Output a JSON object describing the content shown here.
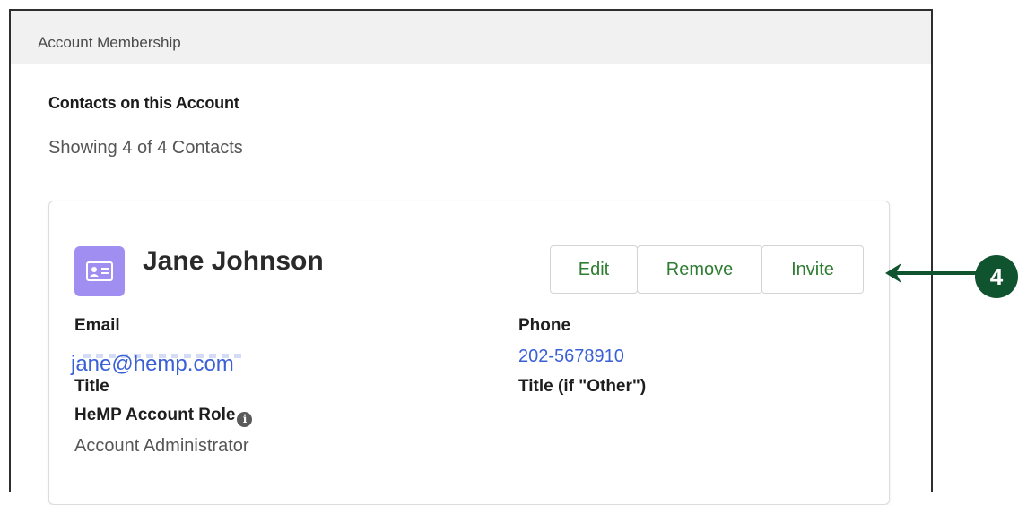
{
  "panel": {
    "header_title": "Account Membership",
    "section_title": "Contacts on this Account",
    "showing_text": "Showing 4 of 4 Contacts"
  },
  "contact": {
    "icon": "contact-card-icon",
    "name": "Jane Johnson",
    "actions": {
      "edit": "Edit",
      "remove": "Remove",
      "invite": "Invite"
    },
    "fields": {
      "email_label": "Email",
      "email_value": "jane@hemp.com",
      "phone_label": "Phone",
      "phone_value": "202-5678910",
      "title_label": "Title",
      "title_other_label": "Title (if \"Other\")",
      "role_label": "HeMP Account Role",
      "role_value": "Account Administrator"
    }
  },
  "callout": {
    "number": "4",
    "color": "#10532f"
  },
  "colors": {
    "accent_green": "#2e7d32",
    "link_blue": "#3a60d6",
    "icon_purple": "#a08ff0"
  }
}
